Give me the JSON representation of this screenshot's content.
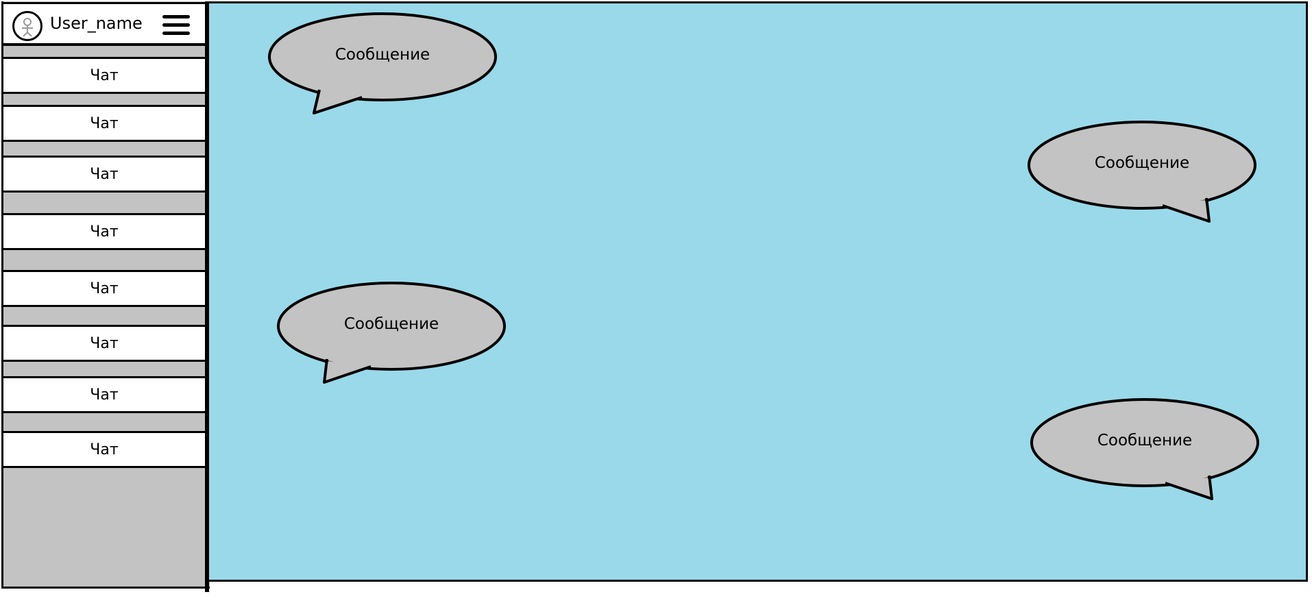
{
  "user": {
    "name": "User_name",
    "avatar_icon": "user-avatar-icon",
    "menu_icon": "hamburger-menu-icon"
  },
  "sidebar": {
    "background": "#c3c3c3",
    "chats": [
      {
        "label": "Чат"
      },
      {
        "label": "Чат"
      },
      {
        "label": "Чат"
      },
      {
        "label": "Чат"
      },
      {
        "label": "Чат"
      },
      {
        "label": "Чат"
      },
      {
        "label": "Чат"
      },
      {
        "label": "Чат"
      }
    ]
  },
  "chat_area": {
    "background": "#99d9ea",
    "bubble_color": "#c3c3c3",
    "messages": [
      {
        "text": "Сообщение",
        "side": "incoming"
      },
      {
        "text": "Сообщение",
        "side": "outgoing"
      },
      {
        "text": "Сообщение",
        "side": "incoming"
      },
      {
        "text": "Сообщение",
        "side": "outgoing"
      }
    ]
  }
}
